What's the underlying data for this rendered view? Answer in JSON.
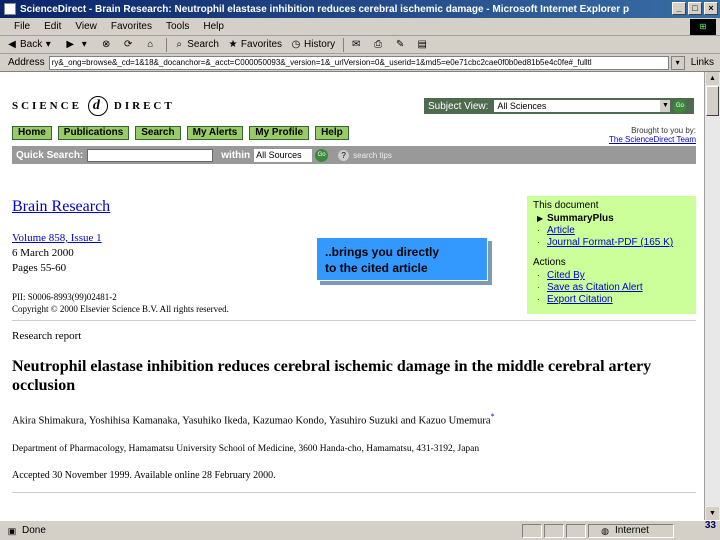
{
  "window": {
    "title": "ScienceDirect - Brain Research: Neutrophil elastase inhibition reduces cerebral ischemic damage - Microsoft Internet Explorer p"
  },
  "menu": [
    "File",
    "Edit",
    "View",
    "Favorites",
    "Tools",
    "Help"
  ],
  "toolbar": {
    "back": "Back",
    "search": "Search",
    "favorites": "Favorites",
    "history": "History"
  },
  "address": {
    "label": "Address",
    "url": "ry&_ong=browse&_cd=1&18&_docanchor=&_acct=C000050093&_version=1&_urlVersion=0&_userid=1&md5=e0e71cbc2cae0f0b0ed81b5e4c0fe#_fulltl",
    "links": "Links"
  },
  "site": {
    "logo_left": "SCIENCE",
    "logo_mark": "d",
    "logo_right": "DIRECT",
    "subject_label": "Subject View:",
    "subject_value": "All Sciences",
    "go": "Go",
    "nav": [
      "Home",
      "Publications",
      "Search",
      "My Alerts",
      "My Profile",
      "Help"
    ],
    "brought_line": "Brought to you by:",
    "brought_team": "The ScienceDirect Team",
    "quick_search_label": "Quick Search:",
    "within_label": "within",
    "within_value": "All Sources",
    "search_tips": "search tips"
  },
  "article": {
    "journal": "Brain Research",
    "volume": "Volume 858, Issue 1",
    "date": "6 March 2000",
    "pages": "Pages 55-60",
    "pii": "PII: S0006-8993(99)02481-2",
    "copyright": "Copyright © 2000 Elsevier Science B.V. All rights reserved.",
    "type": "Research report",
    "title": "Neutrophil elastase inhibition reduces cerebral ischemic damage in the middle cerebral artery occlusion",
    "authors": "Akira Shimakura, Yoshihisa Kamanaka, Yasuhiko Ikeda, Kazumao Kondo, Yasuhiro Suzuki and Kazuo Umemura",
    "author_mark": "*",
    "affiliation": "Department of Pharmacology, Hamamatsu University School of Medicine, 3600 Handa-cho, Hamamatsu, 431-3192, Japan",
    "accepted": "Accepted 30 November 1999.  Available online 28 February 2000."
  },
  "callout": {
    "line1": "..brings you directly",
    "line2": "to the cited article"
  },
  "sidebar": {
    "doc_heading": "This document",
    "summary_plus": "SummaryPlus",
    "article_link": "Article",
    "pdf_link": "Journal Format-PDF (165 K)",
    "actions_heading": "Actions",
    "cited_by": "Cited By",
    "save_alert": "Save as Citation Alert",
    "export": "Export Citation"
  },
  "status": {
    "text": "Done",
    "zone": "Internet",
    "slide_number": "33"
  }
}
